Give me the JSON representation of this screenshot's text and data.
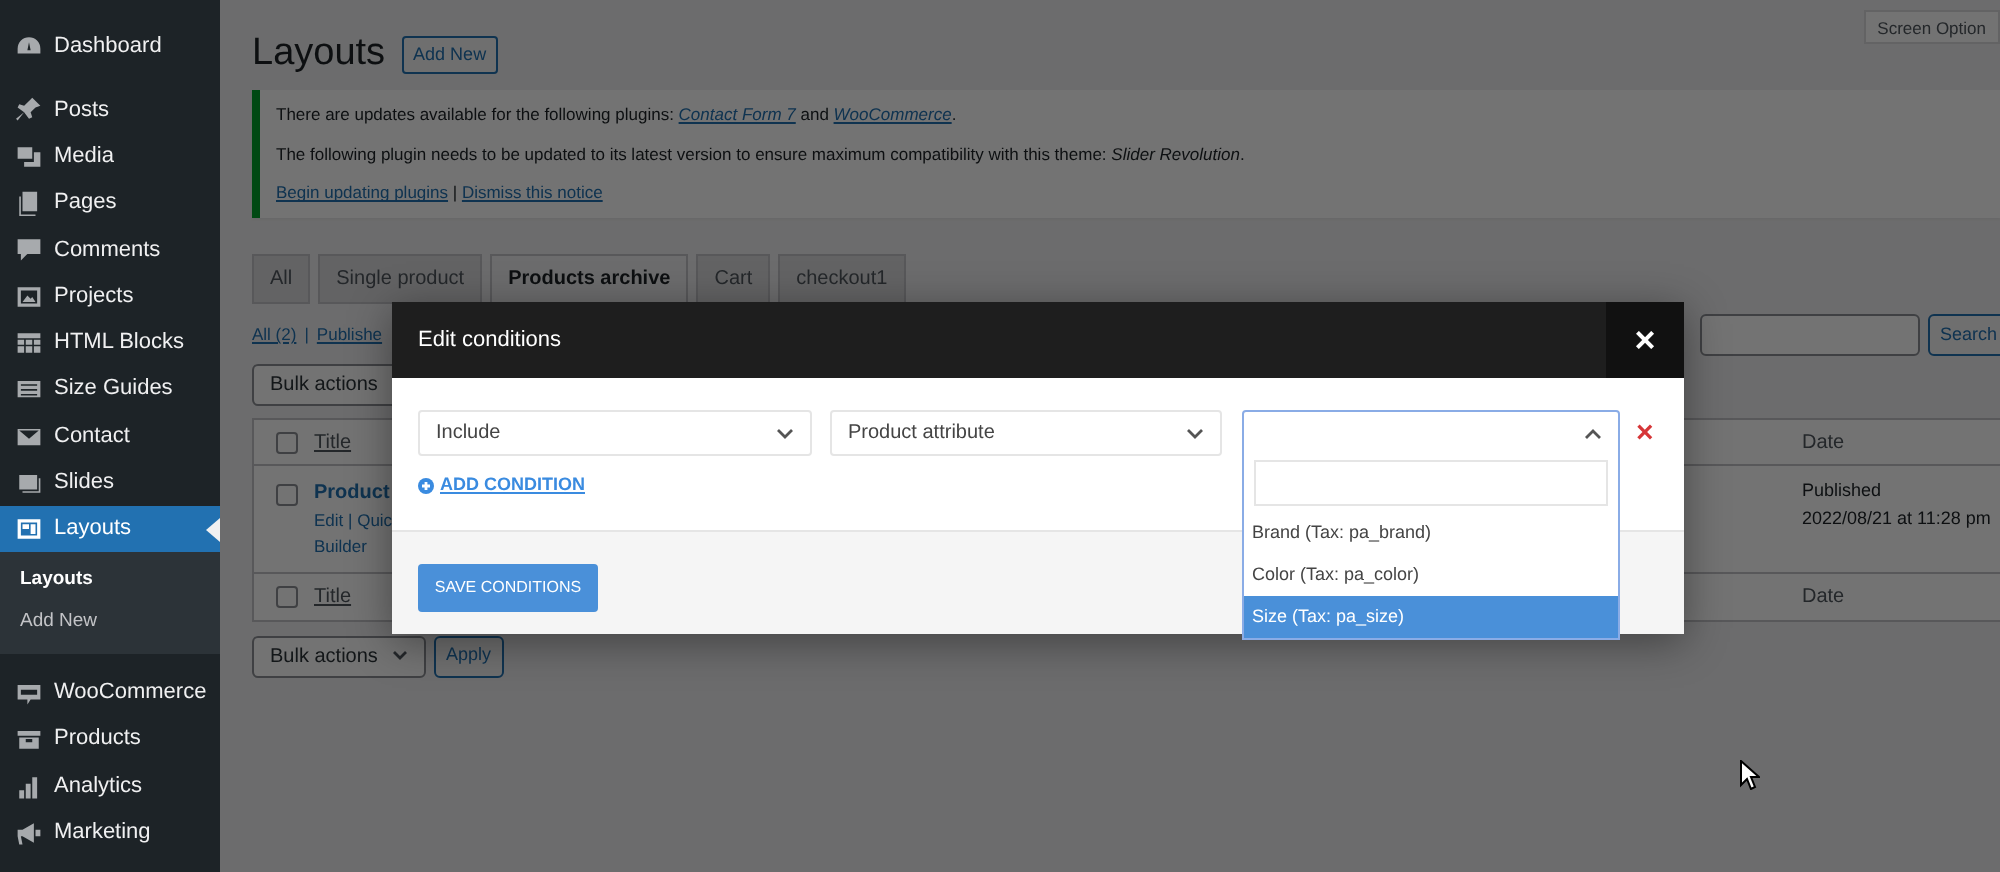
{
  "sidebar": {
    "items": [
      {
        "label": "Dashboard",
        "selected": false
      },
      {
        "label": "Posts",
        "selected": false
      },
      {
        "label": "Media",
        "selected": false
      },
      {
        "label": "Pages",
        "selected": false
      },
      {
        "label": "Comments",
        "selected": false
      },
      {
        "label": "Projects",
        "selected": false
      },
      {
        "label": "HTML Blocks",
        "selected": false
      },
      {
        "label": "Size Guides",
        "selected": false
      },
      {
        "label": "Contact",
        "selected": false
      },
      {
        "label": "Slides",
        "selected": false
      },
      {
        "label": "Layouts",
        "selected": true,
        "children": [
          {
            "label": "Layouts",
            "selected": true
          },
          {
            "label": "Add New",
            "selected": false
          }
        ]
      },
      {
        "label": "WooCommerce",
        "selected": false
      },
      {
        "label": "Products",
        "selected": false
      },
      {
        "label": "Analytics",
        "selected": false
      },
      {
        "label": "Marketing",
        "selected": false
      }
    ]
  },
  "page": {
    "title": "Layouts",
    "add_new": "Add New",
    "screen_options": "Screen Option"
  },
  "notice": {
    "lines": [
      {
        "segments": [
          {
            "text": "There are updates available for the following plugins: ",
            "kind": "text"
          },
          {
            "text": "Contact Form 7",
            "kind": "link"
          },
          {
            "text": " and ",
            "kind": "text"
          },
          {
            "text": "WooCommerce",
            "kind": "link"
          },
          {
            "text": ".",
            "kind": "text"
          }
        ]
      },
      {
        "segments": [
          {
            "text": "The following plugin needs to be updated to its latest version to ensure maximum compatibility with this theme: *Slider Revolution*.",
            "kind": "text"
          }
        ]
      },
      {
        "segments": [
          {
            "text": "Begin updating plugins",
            "kind": "link"
          },
          {
            "text": " | ",
            "kind": "text"
          },
          {
            "text": "Dismiss this notice",
            "kind": "link"
          }
        ]
      }
    ]
  },
  "tabs": [
    {
      "label": "All",
      "selected": false
    },
    {
      "label": "Single product",
      "selected": false
    },
    {
      "label": "Products archive",
      "selected": true
    },
    {
      "label": "Cart",
      "selected": false
    },
    {
      "label": "checkout1",
      "selected": false
    }
  ],
  "filters": {
    "all": "All (2)",
    "separator": "|",
    "published": "Publishe"
  },
  "search": {
    "button": "Search"
  },
  "bulk_top": {
    "label": "Bulk actions"
  },
  "table": {
    "columns": [
      "Title",
      "Date"
    ],
    "header_checkbox": {
      "checked": false
    },
    "rows": [
      {
        "checked": false,
        "title": "Product",
        "actions": "Edit | Quic",
        "actions_2": "Builder",
        "status": "Published",
        "date": "2022/08/21 at 11:28 pm"
      }
    ],
    "footer": [
      "Title",
      "Date"
    ],
    "footer_checkbox": {
      "checked": false
    }
  },
  "bulk_bottom": {
    "label": "Bulk actions",
    "apply": "Apply"
  },
  "modal": {
    "title": "Edit conditions",
    "close": "×",
    "selects": [
      {
        "value": "Include",
        "open": false
      },
      {
        "value": "Product attribute",
        "open": false
      },
      {
        "open": true
      }
    ],
    "remove": "×",
    "add_condition": "ADD CONDITION",
    "save": "SAVE CONDITIONS",
    "options": [
      {
        "label": "Brand (Tax: pa_brand)",
        "selected": false
      },
      {
        "label": "Color (Tax: pa_color)",
        "selected": false
      },
      {
        "label": "Size (Tax: pa_size)",
        "selected": true
      }
    ]
  }
}
